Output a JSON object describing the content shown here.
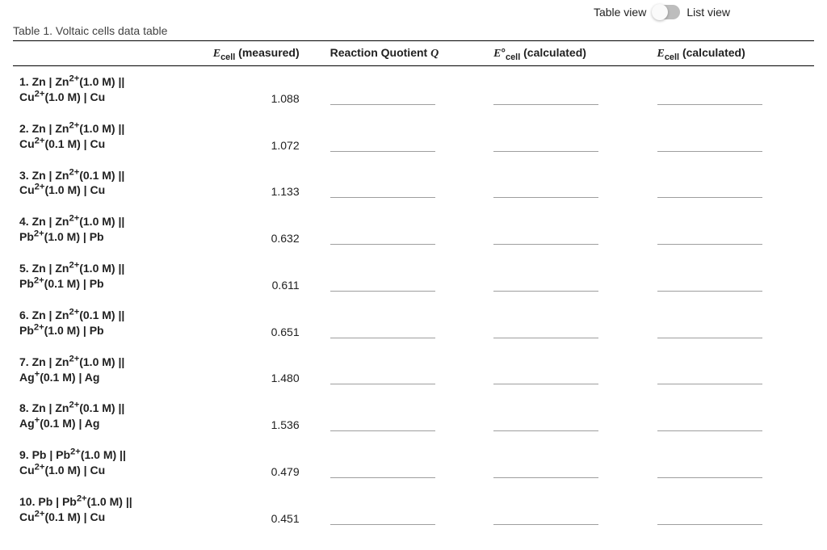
{
  "viewSwitch": {
    "leftLabel": "Table view",
    "rightLabel": "List view"
  },
  "table": {
    "caption": "Table 1. Voltaic cells data table",
    "headers": {
      "measured_html": "<span class='italic'>E</span><sub>cell</sub> (measured)",
      "q_html": "Reaction Quotient <span class='italic'>Q</span>",
      "e0calc_html": "<span class='italic'>E</span>°<sub>cell</sub> (calculated)",
      "ecalc_html": "<span class='italic'>E</span><sub>cell</sub> (calculated)"
    },
    "rows": [
      {
        "label_html": "1. Zn | Zn<sup>2+</sup>(1.0 M) ||<br>Cu<sup>2+</sup>(1.0 M) | Cu",
        "measured": "1.088"
      },
      {
        "label_html": "2. Zn | Zn<sup>2+</sup>(1.0 M) ||<br>Cu<sup>2+</sup>(0.1 M) | Cu",
        "measured": "1.072"
      },
      {
        "label_html": "3. Zn | Zn<sup>2+</sup>(0.1 M) ||<br>Cu<sup>2+</sup>(1.0 M) | Cu",
        "measured": "1.133"
      },
      {
        "label_html": "4. Zn | Zn<sup>2+</sup>(1.0 M) ||<br>Pb<sup>2+</sup>(1.0 M) | Pb",
        "measured": "0.632"
      },
      {
        "label_html": "5. Zn | Zn<sup>2+</sup>(1.0 M) ||<br>Pb<sup>2+</sup>(0.1 M) | Pb",
        "measured": "0.611"
      },
      {
        "label_html": "6. Zn | Zn<sup>2+</sup>(0.1 M) ||<br>Pb<sup>2+</sup>(1.0 M) | Pb",
        "measured": "0.651"
      },
      {
        "label_html": "7. Zn | Zn<sup>2+</sup>(1.0 M) ||<br>Ag<sup>+</sup>(0.1 M) | Ag",
        "measured": "1.480"
      },
      {
        "label_html": "8. Zn | Zn<sup>2+</sup>(0.1 M) ||<br>Ag<sup>+</sup>(0.1 M) | Ag",
        "measured": "1.536"
      },
      {
        "label_html": "9. Pb | Pb<sup>2+</sup>(1.0 M) ||<br>Cu<sup>2+</sup>(1.0 M) | Cu",
        "measured": "0.479"
      },
      {
        "label_html": "10. Pb | Pb<sup>2+</sup>(1.0 M) ||<br>Cu<sup>2+</sup>(0.1 M) | Cu",
        "measured": "0.451"
      }
    ]
  }
}
